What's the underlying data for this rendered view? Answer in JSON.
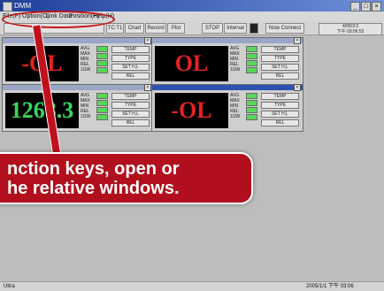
{
  "window": {
    "title": "DMM"
  },
  "menu": {
    "items": [
      "File(F)",
      "Option(O)",
      "Link Data",
      "Position(P)",
      "Help(H)"
    ]
  },
  "toolbar": {
    "buttons": [
      "TC:T1",
      "Chart",
      "Record",
      "Plot",
      "STOP",
      "Interval"
    ],
    "status": "Now Connect",
    "info_line1": "4/05/3:3",
    "info_line2": "下午 03:06:52"
  },
  "meters": [
    {
      "reading": "-OL",
      "color": "red"
    },
    {
      "reading": "OL",
      "color": "red"
    },
    {
      "reading": "1268.3",
      "color": "green"
    },
    {
      "reading": "-OL",
      "color": "red"
    }
  ],
  "meter_labels": {
    "modes": [
      "AVG",
      "MAX",
      "MIN",
      "REL",
      "1ΩW"
    ],
    "temp": "TEMP",
    "type": "TYPE",
    "set_hl": "SET H,L",
    "rel": "REL"
  },
  "callout": {
    "line1": "nction keys, open or",
    "line2": "he relative windows."
  },
  "statusbar": {
    "left": "Ultra",
    "right": "2005/1/1   下午 03:06"
  },
  "colors": {
    "callout": "#b10f1d",
    "title_bar": "#1d3f9a",
    "ellipse": "#c41414"
  }
}
